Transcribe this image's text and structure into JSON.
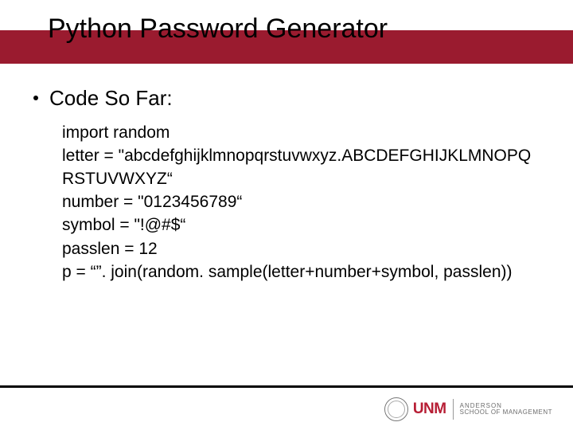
{
  "title": "Python Password Generator",
  "heading": "Code So Far:",
  "code": {
    "l1": "import random",
    "l2": "letter = \"abcdefghijklmnopqrstuvwxyz.ABCDEFGHIJKLMNOPQRSTUVWXYZ“",
    "l3": "number = \"0123456789“",
    "l4": "symbol = \"!@#$“",
    "l5": "passlen = 12",
    "l6": "p = “”. join(random. sample(letter+number+symbol, passlen))"
  },
  "footer": {
    "unm": "UNM",
    "school_top": "ANDERSON",
    "school_bot": "SCHOOL OF MANAGEMENT"
  }
}
